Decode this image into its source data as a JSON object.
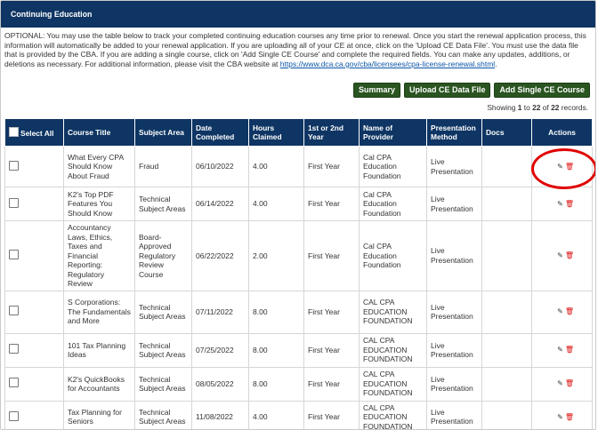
{
  "panel": {
    "title": "Continuing Education"
  },
  "intro": {
    "text": "OPTIONAL: You may use the table below to track your completed continuing education courses any time prior to renewal. Once you start the renewal application process, this information will automatically be added to your renewal application.  If you are uploading all of your CE at once, click on the 'Upload CE Data File'. You must use the data file that is provided by the CBA.  If you are adding a single course, click on 'Add Single CE Course' and complete the required fields.  You can make any updates, additions, or deletions as necessary.  For additional information, please visit the CBA website at ",
    "link": "https://www.dca.ca.gov/cba/licensees/cpa-license-renewal.shtml",
    "after": "."
  },
  "buttons": {
    "summary": "Summary",
    "upload": "Upload CE Data File",
    "add": "Add Single CE Course"
  },
  "showing": {
    "prefix": "Showing ",
    "from": "1",
    "to_word": " to ",
    "to": "22",
    "of_word": " of ",
    "total": "22",
    "suffix": " records."
  },
  "table": {
    "headers": [
      "Select All",
      "Course Title",
      "Subject Area",
      "Date Completed",
      "Hours Claimed",
      "1st or 2nd Year",
      "Name of Provider",
      "Presentation Method",
      "Docs",
      "Actions"
    ],
    "rows": [
      {
        "title": "What Every CPA Should Know About Fraud",
        "subject": "Fraud",
        "date": "06/10/2022",
        "hours": "4.00",
        "year": "First Year",
        "provider": "Cal CPA Education Foundation",
        "method": "Live Presentation",
        "docs": ""
      },
      {
        "title": "K2's Top PDF Features You Should Know",
        "subject": "Technical Subject Areas",
        "date": "06/14/2022",
        "hours": "4.00",
        "year": "First Year",
        "provider": "Cal CPA Education Foundation",
        "method": "Live Presentation",
        "docs": ""
      },
      {
        "title": "Accountancy Laws, Ethics, Taxes and Financial Reporting: Regulatory Review",
        "subject": "Board-Approved Regulatory Review Course",
        "date": "06/22/2022",
        "hours": "2.00",
        "year": "First Year",
        "provider": "Cal CPA Education Foundation",
        "method": "Live Presentation",
        "docs": ""
      },
      {
        "title": "S Corporations: The Fundamentals and More",
        "subject": "Technical Subject Areas",
        "date": "07/11/2022",
        "hours": "8.00",
        "year": "First Year",
        "provider": "CAL CPA EDUCATION FOUNDATION",
        "method": "Live Presentation",
        "docs": ""
      },
      {
        "title": "101 Tax Planning Ideas",
        "subject": "Technical Subject Areas",
        "date": "07/25/2022",
        "hours": "8.00",
        "year": "First Year",
        "provider": "CAL CPA EDUCATION FOUNDATION",
        "method": "Live Presentation",
        "docs": ""
      },
      {
        "title": "K2's QuickBooks for Accountants",
        "subject": "Technical Subject Areas",
        "date": "08/05/2022",
        "hours": "8.00",
        "year": "First Year",
        "provider": "CAL CPA EDUCATION FOUNDATION",
        "method": "Live Presentation",
        "docs": ""
      },
      {
        "title": "Tax Planning for Seniors",
        "subject": "Technical Subject Areas",
        "date": "11/08/2022",
        "hours": "4.00",
        "year": "First Year",
        "provider": "CAL CPA EDUCATION FOUNDATION",
        "method": "Live Presentation",
        "docs": ""
      }
    ],
    "edit_icon": "pencil-icon",
    "delete_icon": "trash-icon"
  },
  "highlight_color": "#e00000"
}
